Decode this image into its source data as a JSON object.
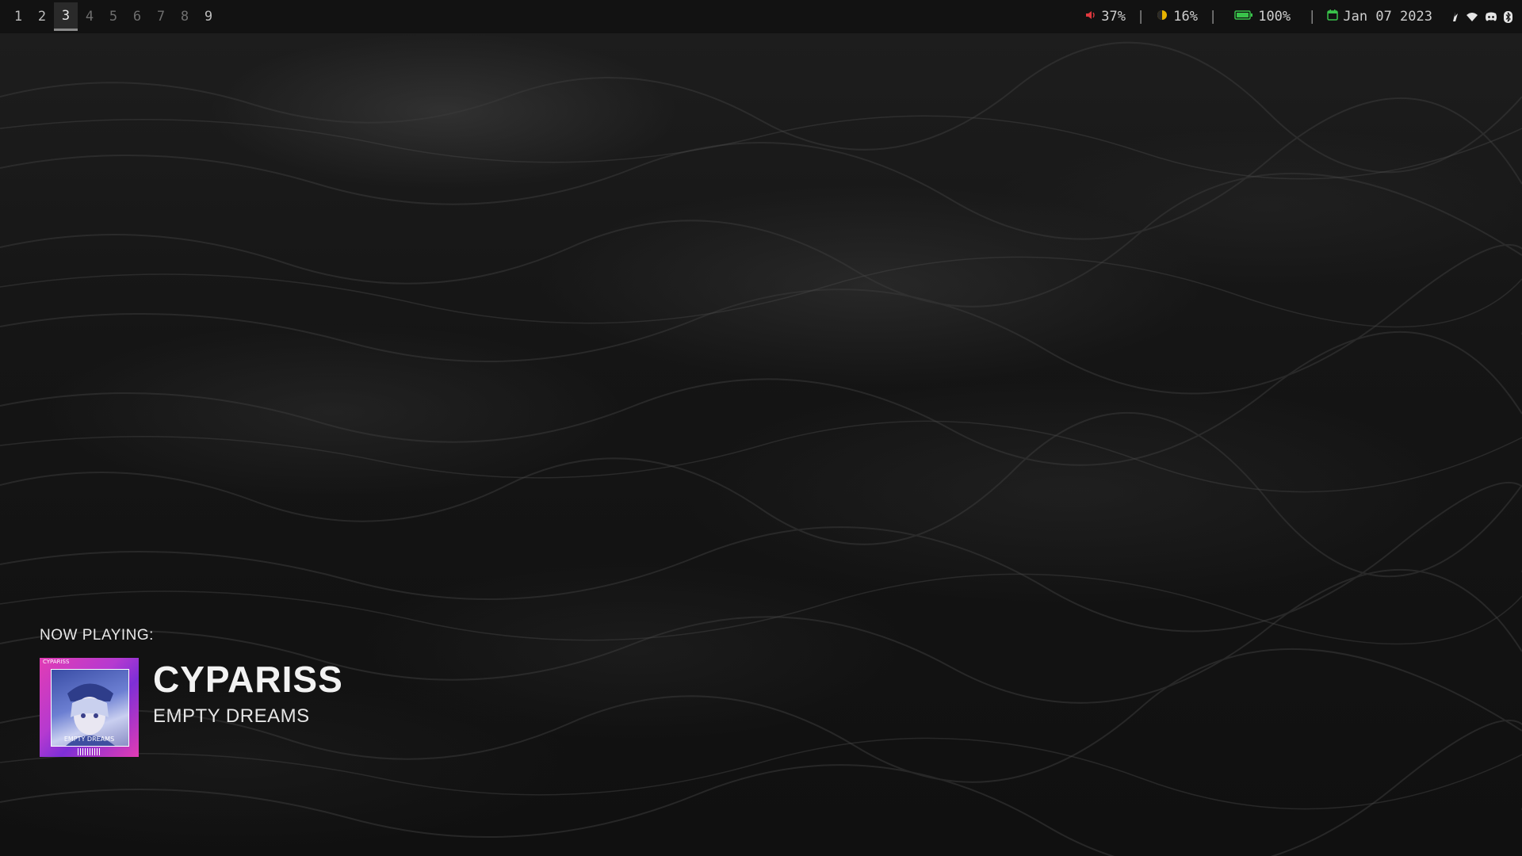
{
  "workspaces": [
    {
      "label": "1",
      "state": "occupied"
    },
    {
      "label": "2",
      "state": "occupied"
    },
    {
      "label": "3",
      "state": "active"
    },
    {
      "label": "4",
      "state": "empty"
    },
    {
      "label": "5",
      "state": "empty"
    },
    {
      "label": "6",
      "state": "empty"
    },
    {
      "label": "7",
      "state": "empty"
    },
    {
      "label": "8",
      "state": "empty"
    },
    {
      "label": "9",
      "state": "occupied"
    }
  ],
  "status": {
    "volume": {
      "icon": "speaker-icon",
      "value": "37%",
      "color": "#e0383e"
    },
    "brightness": {
      "icon": "brightness-icon",
      "value": "16%",
      "color": "#e8b400"
    },
    "battery": {
      "icon": "battery-icon",
      "value": "100%",
      "color": "#39c24a"
    },
    "date": {
      "icon": "calendar-icon",
      "value": "Jan 07 2023",
      "color": "#39c24a"
    },
    "tray": [
      "flame-icon",
      "wifi-icon",
      "discord-icon",
      "bluetooth-icon"
    ]
  },
  "now_playing": {
    "label": "NOW PLAYING:",
    "title": "CYPARISS",
    "subtitle": "EMPTY DREAMS",
    "cover": {
      "tag": "CYPARISS",
      "caption": "EMPTY DREAMS",
      "accent": "#e23cb4"
    }
  }
}
